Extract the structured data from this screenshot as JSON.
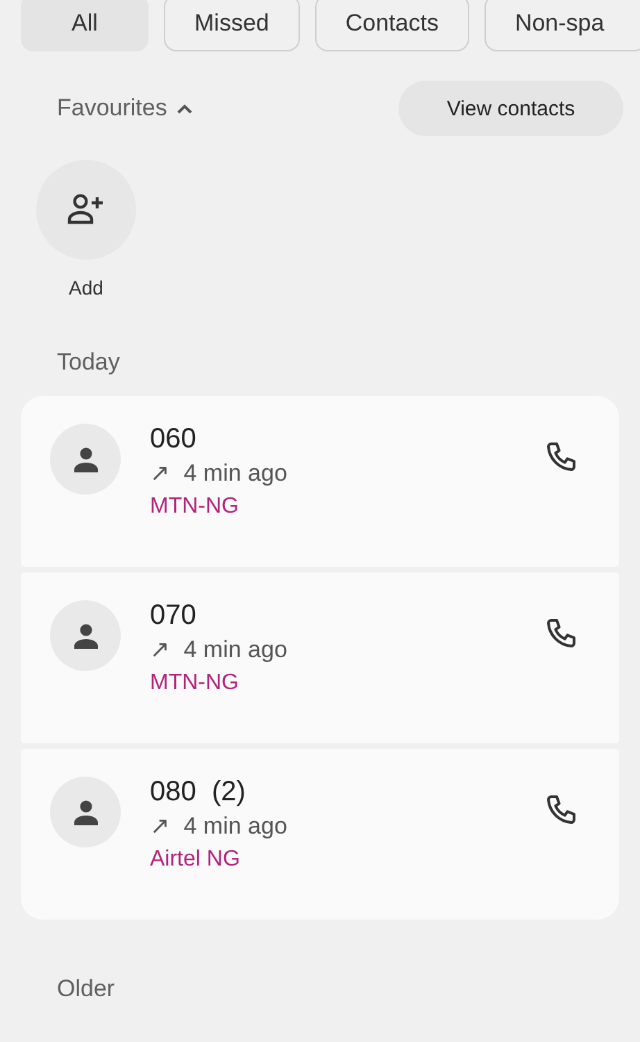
{
  "filters": [
    {
      "label": "All",
      "selected": true
    },
    {
      "label": "Missed",
      "selected": false
    },
    {
      "label": "Contacts",
      "selected": false
    },
    {
      "label": "Non-spa",
      "selected": false
    }
  ],
  "favourites": {
    "title": "Favourites",
    "expanded": true,
    "action": "View contacts",
    "add_label": "Add"
  },
  "sections": [
    {
      "title": "Today",
      "calls": [
        {
          "number": "060",
          "direction": "↗",
          "time": "4 min ago",
          "carrier": "MTN-NG"
        },
        {
          "number": "070",
          "direction": "↗",
          "time": "4 min ago",
          "carrier": "MTN-NG"
        },
        {
          "number": "080",
          "count": "(2)",
          "direction": "↗",
          "time": "4 min ago",
          "carrier": "Airtel NG"
        }
      ]
    },
    {
      "title": "Older"
    }
  ]
}
